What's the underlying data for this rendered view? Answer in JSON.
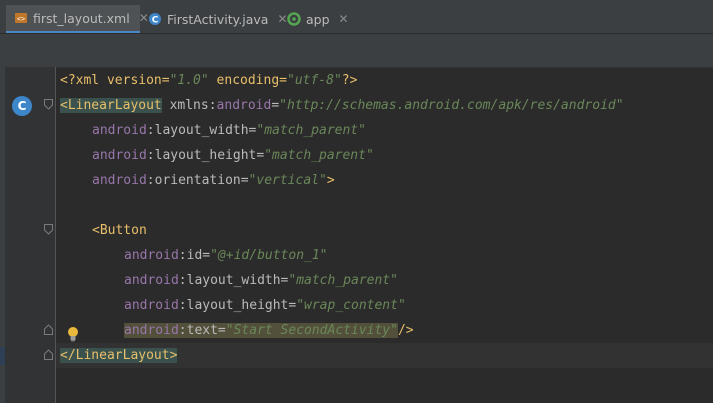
{
  "tabs": [
    {
      "label": "first_layout.xml",
      "active": true,
      "icon": "xml-file-icon"
    },
    {
      "label": "FirstActivity.java",
      "active": false,
      "icon": "java-class-icon"
    },
    {
      "label": "app",
      "active": false,
      "icon": "gradle-module-icon"
    }
  ],
  "gutter": {
    "class_badge": "C"
  },
  "code": {
    "l1": {
      "open": "<?xml version=",
      "v1": "\"1.0\"",
      "mid": " encoding=",
      "v2": "\"utf-8\"",
      "close": "?>"
    },
    "l2": {
      "tag": "<LinearLayout",
      "attr": " xmlns:",
      "ns": "android",
      "eq": "=",
      "val": "\"http://schemas.android.com/apk/res/android\""
    },
    "l3": {
      "ns": "android",
      "attr": ":layout_width=",
      "val": "\"match_parent\""
    },
    "l4": {
      "ns": "android",
      "attr": ":layout_height=",
      "val": "\"match_parent\""
    },
    "l5": {
      "ns": "android",
      "attr": ":orientation=",
      "val": "\"vertical\"",
      "close": ">"
    },
    "l7": {
      "tag": "<Button"
    },
    "l8": {
      "ns": "android",
      "attr": ":id=",
      "val": "\"@+id/button_1\""
    },
    "l9": {
      "ns": "android",
      "attr": ":layout_width=",
      "val": "\"match_parent\""
    },
    "l10": {
      "ns": "android",
      "attr": ":layout_height=",
      "val": "\"wrap_content\""
    },
    "l11": {
      "ns": "android",
      "attr": ":text=",
      "val": "\"Start SecondActivity\"",
      "close": "/>"
    },
    "l12": {
      "tag": "</LinearLayout>"
    }
  },
  "colors": {
    "background": "#2b2b2b",
    "tag": "#e8bf6a",
    "string": "#6a8759",
    "namespace": "#9876aa",
    "accent": "#4a88c7"
  }
}
